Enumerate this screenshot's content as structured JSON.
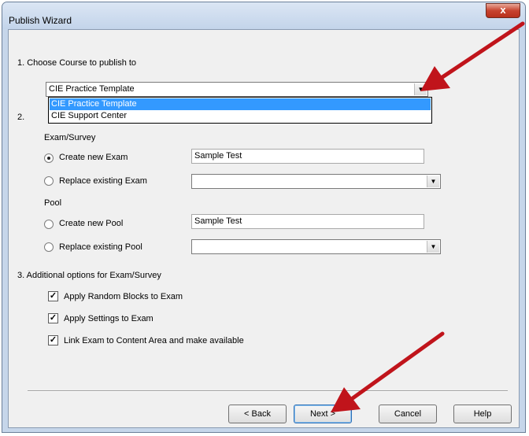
{
  "window": {
    "title": "Publish Wizard",
    "close_glyph": "x"
  },
  "section1": {
    "label": "1. Choose Course to publish to",
    "course_select": {
      "value": "CIE Practice Template",
      "arrow": "▼"
    },
    "dropdown_options": [
      "CIE Practice Template",
      "CIE Support Center"
    ]
  },
  "section2": {
    "label": "2.",
    "exam": {
      "heading": "Exam/Survey",
      "create_label": "Create new Exam",
      "create_value": "Sample Test",
      "replace_label": "Replace existing Exam",
      "replace_value": ""
    },
    "pool": {
      "heading": "Pool",
      "create_label": "Create new Pool",
      "create_value": "Sample Test",
      "replace_label": "Replace existing Pool",
      "replace_value": ""
    }
  },
  "section3": {
    "label": "3. Additional options for Exam/Survey",
    "options": [
      {
        "label": "Apply Random Blocks to Exam",
        "checked": true
      },
      {
        "label": "Apply Settings to Exam",
        "checked": true
      },
      {
        "label": "Link Exam to Content Area and make available",
        "checked": true
      }
    ],
    "check_glyph": "✓"
  },
  "buttons": {
    "back": "< Back",
    "next": "Next >",
    "cancel": "Cancel",
    "help": "Help"
  },
  "annotation": {
    "arrow_color": "#c0141b"
  },
  "colors": {
    "selection": "#3399ff",
    "frame": "#c6d6ea",
    "close": "#c7432f"
  }
}
